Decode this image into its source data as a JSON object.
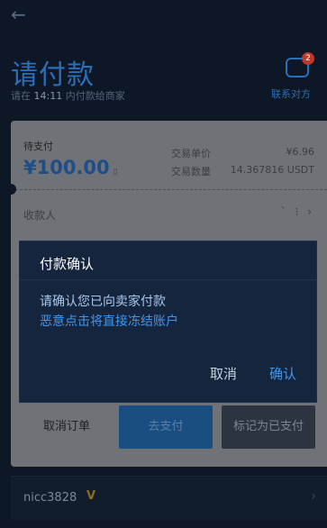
{
  "header": {
    "back_icon": "arrow-left-icon",
    "title": "请付款",
    "subtitle_prefix": "请在",
    "deadline": "14:11",
    "subtitle_suffix": "内付款给商家",
    "contact_badge": "2",
    "contact_label": "联系对方"
  },
  "order": {
    "pending_label": "待支付",
    "amount": "¥100.00",
    "unit_price_label": "交易单价",
    "unit_price_value": "¥6.96",
    "quantity_label": "交易数量",
    "quantity_value": "14.367816 USDT",
    "payee_label": "收款人"
  },
  "actions": {
    "cancel_order": "取消订单",
    "go_pay": "去支付",
    "mark_paid": "标记为已支付"
  },
  "merchant": {
    "name": "nicc3828",
    "verified_icon": "v-badge-icon"
  },
  "dialog": {
    "title": "付款确认",
    "message": "请确认您已向卖家付款",
    "warning": "恶意点击将直接冻结账户",
    "cancel": "取消",
    "confirm": "确认"
  },
  "colors": {
    "accent": "#3d97f0",
    "dialog_bg": "#16253e",
    "page_bg": "#0d1725"
  }
}
